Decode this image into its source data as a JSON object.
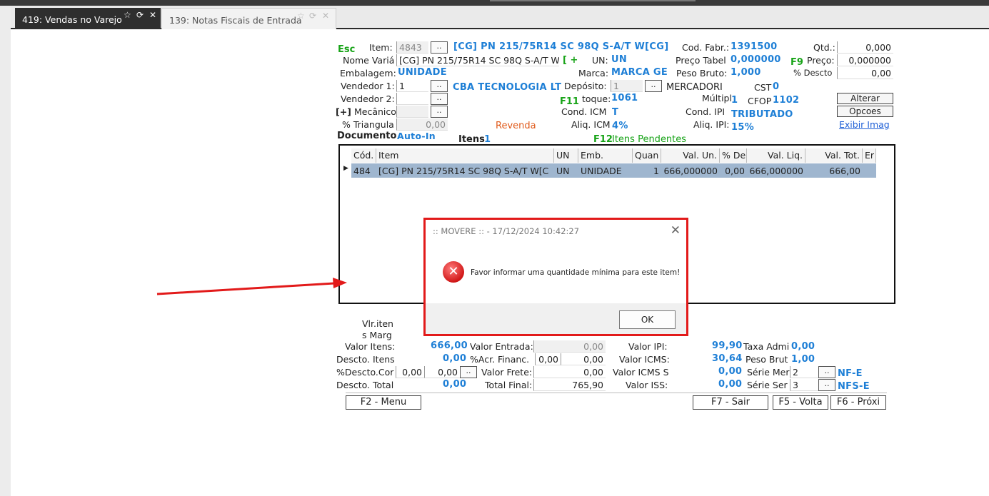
{
  "tabs": [
    {
      "label": "419: Vendas no Varejo"
    },
    {
      "label": "139: Notas Fiscais de Entrada"
    }
  ],
  "form": {
    "esc": "Esc",
    "item_label": "Item:",
    "item_code": "4843",
    "item_desc": "[CG] PN 215/75R14 SC 98Q S-A/T W[CG]",
    "nome_variacao_label": "Nome Variá",
    "nome_variacao_value": "[CG] PN 215/75R14 SC 98Q S-A/T W",
    "bracket_plus": "[ +",
    "embalagem_label": "Embalagem:",
    "embalagem_value": "UNIDADE",
    "vendedor1_label": "Vendedor 1:",
    "vendedor1_value": "1",
    "vendedor1_name": "CBA TECNOLOGIA LT",
    "vendedor2_label": "Vendedor 2:",
    "mecanico_plus": "[+]",
    "mecanico_label": "Mecânico",
    "triangula_label": "% Triangula",
    "triangula_value": "0,00",
    "revenda": "Revenda",
    "documento_label": "Documento",
    "documento_value": "Auto-In",
    "itens_label": "Itens",
    "itens_value": "1",
    "f12": "F12",
    "itens_pendentes": "Itens Pendentes",
    "un_label": "UN:",
    "un_value": "UN",
    "marca_label": "Marca:",
    "marca_value": "MARCA GE",
    "deposito_label": "Depósito:",
    "deposito_value": "1",
    "deposito_name": "MERCADORI",
    "f11": "F11",
    "estoque_label": "toque:",
    "estoque_value": "1061",
    "cond_icm_label": "Cond. ICM",
    "cond_icm_value": "T",
    "aliq_icm_label": "Aliq. ICM",
    "aliq_icm_value": "4%",
    "cod_fabr_label": "Cod. Fabr.:",
    "cod_fabr_value": "1391500",
    "preco_tabel_label": "Preço Tabel",
    "preco_tabel_value": "0,000000",
    "peso_bruto_label": "Peso Bruto:",
    "peso_bruto_value": "1,000",
    "cst_label": "CST",
    "cst_value": "0",
    "multipl_label": "Múltipl",
    "multipl_value": "1",
    "cfop_label": "CFOP",
    "cfop_value": "1102",
    "cond_ipi_label": "Cond. IPI",
    "cond_ipi_value": "TRIBUTADO",
    "aliq_ipi_label": "Aliq. IPI:",
    "aliq_ipi_value": "15%",
    "f9": "F9",
    "qtd_label": "Qtd.:",
    "qtd_value": "0,000",
    "preco_label": "Preço:",
    "preco_value": "0,000000",
    "descto_label": "% Descto",
    "descto_value": "0,00",
    "alterar_label": "Alterar",
    "opcoes_label": "Opcoes",
    "exibir_imag_label": "Exibir Imag"
  },
  "grid": {
    "headers": [
      "Cód.",
      "Item",
      "UN",
      "Emb.",
      "Quan",
      "Val. Un.",
      "% De",
      "Val. Liq.",
      "Val. Tot.",
      "Er"
    ],
    "rows": [
      [
        "484",
        "[CG] PN 215/75R14 SC 98Q S-A/T W[C",
        "UN",
        "UNIDADE",
        "1",
        "666,000000",
        "0,00",
        "666,000000",
        "666,00",
        ""
      ]
    ]
  },
  "totals": {
    "vlr_item_label": "Vlr.iten",
    "marg_label": "s Marg",
    "valor_itens_label": "Valor Itens:",
    "valor_itens_value": "666,00",
    "descto_itens_label": "Descto. Itens",
    "descto_itens_value": "0,00",
    "pdescto_cor_label": "%Descto.Cor",
    "pdescto_cor_value1": "0,00",
    "pdescto_cor_value2": "0,00",
    "descto_total_label": "Descto. Total",
    "descto_total_value": "0,00",
    "valor_entrada_label": "Valor Entrada:",
    "valor_entrada_value": "0,00",
    "acr_financ_label": "%Acr. Financ.",
    "acr_financ_value1": "0,00",
    "acr_financ_value2": "0,00",
    "valor_frete_label": "Valor Frete:",
    "valor_frete_value": "0,00",
    "total_final_label": "Total Final:",
    "total_final_value": "765,90",
    "valor_ipi_label": "Valor IPI:",
    "valor_ipi_value": "99,90",
    "valor_icms_label": "Valor ICMS:",
    "valor_icms_value": "30,64",
    "valor_icms_s_label": "Valor ICMS S",
    "valor_icms_s_value": "0,00",
    "valor_iss_label": "Valor ISS:",
    "valor_iss_value": "0,00",
    "taxa_admi_label": "Taxa Admi",
    "taxa_admi_value": "0,00",
    "peso_brut_label": "Peso Brut",
    "peso_brut_value": "1,00",
    "serie_mer_label": "Série Mer",
    "serie_mer_value": "2",
    "serie_mer_type": "NF-E",
    "serie_ser_label": "Série Ser",
    "serie_ser_value": "3",
    "serie_ser_type": "NFS-E"
  },
  "fkeys": {
    "f2": "F2 - Menu",
    "f7": "F7 - Sair",
    "f5": "F5 - Volta",
    "f6": "F6 - Próxi"
  },
  "dialog": {
    "title": ":: MOVERE :: - 17/12/2024 10:42:27",
    "message": "Favor informar uma quantidade mínima para este item!",
    "ok_label": "OK"
  },
  "colors": {
    "value_blue": "#1e7fd6",
    "hotkey_green": "#17a317",
    "highlight_row": "#9fb6cf",
    "annotation_red": "#e21a1a"
  }
}
